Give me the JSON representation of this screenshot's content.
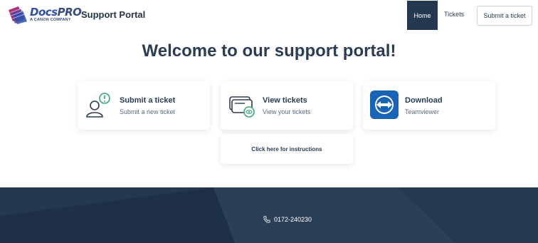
{
  "header": {
    "logo_brand": "Docs",
    "logo_brand_pro": "PRO",
    "logo_sub": "A CANON COMPANY",
    "portal_title": "Support Portal",
    "nav": {
      "home": "Home",
      "tickets": "Tickets",
      "submit": "Submit a ticket"
    }
  },
  "main": {
    "welcome": "Welcome to our support portal!",
    "cards": [
      {
        "title": "Submit a ticket",
        "subtitle": "Submit a new ticket",
        "icon": "user-alert-icon"
      },
      {
        "title": "View tickets",
        "subtitle": "View your tickets",
        "icon": "ticket-view-icon"
      },
      {
        "title": "Download",
        "subtitle": "Teamviewer",
        "icon": "teamviewer-icon"
      }
    ],
    "instructions": "Click here for instructions"
  },
  "footer": {
    "phone": "0172-240230",
    "phone_icon": "phone-icon"
  },
  "colors": {
    "primary": "#24384f",
    "heading": "#2a3d55",
    "teamviewer": "#1a64b8",
    "accent_green": "#3aa57a"
  }
}
